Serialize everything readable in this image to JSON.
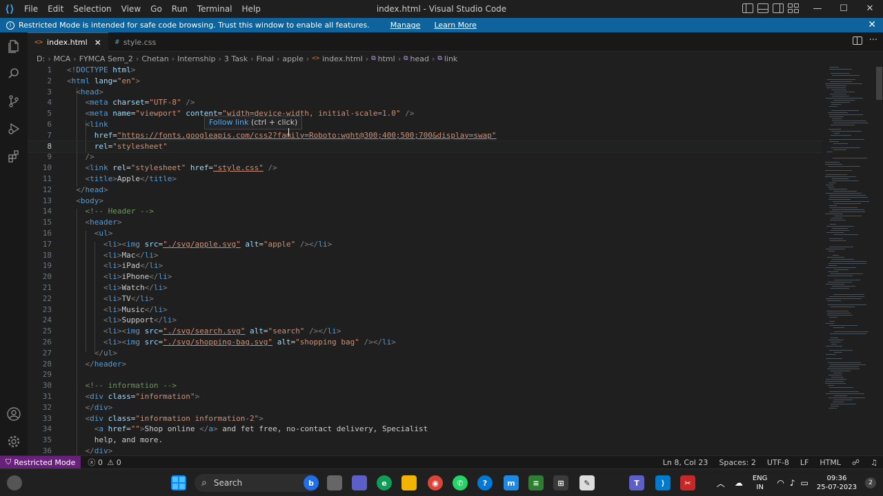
{
  "titlebar": {
    "menu": [
      "File",
      "Edit",
      "Selection",
      "View",
      "Go",
      "Run",
      "Terminal",
      "Help"
    ],
    "title": "index.html - Visual Studio Code",
    "controls": [
      "—",
      "☐",
      "✕"
    ]
  },
  "banner": {
    "message": "Restricted Mode is intended for safe code browsing. Trust this window to enable all features.",
    "manage": "Manage",
    "learn_more": "Learn More"
  },
  "tabs": [
    {
      "icon": "<>",
      "label": "index.html"
    },
    {
      "icon": "#",
      "label": "style.css"
    }
  ],
  "breadcrumbs": [
    "D:",
    "MCA",
    "FYMCA Sem_2",
    "Chetan",
    "Internship",
    "3 Task",
    "Final",
    "apple",
    "index.html",
    "html",
    "head",
    "link"
  ],
  "hover": {
    "link": "Follow link",
    "hint": " (ctrl + click)"
  },
  "editor": {
    "current_line": 8,
    "lines": [
      {
        "n": "1",
        "code": "<!DOCTYPE html>"
      },
      {
        "n": "2",
        "code": "<html lang=\"en\">"
      },
      {
        "n": "3",
        "code": "  <head>"
      },
      {
        "n": "4",
        "code": "    <meta charset=\"UTF-8\" />"
      },
      {
        "n": "5",
        "code": "    <meta name=\"viewport\" content=\"width=device-width, initial-scale=1.0\" />"
      },
      {
        "n": "6",
        "code": "    <link"
      },
      {
        "n": "7",
        "code": "      href=\"https://fonts.googleapis.com/css2?family=Roboto:wght@300;400;500;700&display=swap\""
      },
      {
        "n": "8",
        "code": "      rel=\"stylesheet\""
      },
      {
        "n": "9",
        "code": "    />"
      },
      {
        "n": "10",
        "code": "    <link rel=\"stylesheet\" href=\"style.css\" />"
      },
      {
        "n": "11",
        "code": "    <title>Apple</title>"
      },
      {
        "n": "12",
        "code": "  </head>"
      },
      {
        "n": "13",
        "code": "  <body>"
      },
      {
        "n": "14",
        "code": "    <!-- Header -->"
      },
      {
        "n": "15",
        "code": "    <header>"
      },
      {
        "n": "16",
        "code": "      <ul>"
      },
      {
        "n": "17",
        "code": "        <li><img src=\"./svg/apple.svg\" alt=\"apple\" /></li>"
      },
      {
        "n": "18",
        "code": "        <li>Mac</li>"
      },
      {
        "n": "19",
        "code": "        <li>iPad</li>"
      },
      {
        "n": "20",
        "code": "        <li>iPhone</li>"
      },
      {
        "n": "21",
        "code": "        <li>Watch</li>"
      },
      {
        "n": "22",
        "code": "        <li>TV</li>"
      },
      {
        "n": "23",
        "code": "        <li>Music</li>"
      },
      {
        "n": "24",
        "code": "        <li>Support</li>"
      },
      {
        "n": "25",
        "code": "        <li><img src=\"./svg/search.svg\" alt=\"search\" /></li>"
      },
      {
        "n": "26",
        "code": "        <li><img src=\"./svg/shopping-bag.svg\" alt=\"shopping bag\" /></li>"
      },
      {
        "n": "27",
        "code": "      </ul>"
      },
      {
        "n": "28",
        "code": "    </header>"
      },
      {
        "n": "29",
        "code": ""
      },
      {
        "n": "30",
        "code": "    <!-- information -->"
      },
      {
        "n": "31",
        "code": "    <div class=\"information\">"
      },
      {
        "n": "32",
        "code": "    </div>"
      },
      {
        "n": "33",
        "code": "    <div class=\"information information-2\">"
      },
      {
        "n": "34",
        "code": "      <a href=\"\">Shop online </a> and fet free, no-contact delivery, Specialist"
      },
      {
        "n": "35",
        "code": "      help, and more."
      },
      {
        "n": "36",
        "code": "    </div>"
      }
    ]
  },
  "statusbar": {
    "mode": "Restricted Mode",
    "errors": "0",
    "warnings": "0",
    "position": "Ln 8, Col 23",
    "spaces": "Spaces: 2",
    "encoding": "UTF-8",
    "eol": "LF",
    "language": "HTML"
  },
  "taskbar": {
    "search": "Search",
    "lang_top": "ENG",
    "lang_bottom": "IN",
    "time": "09:36",
    "date": "25-07-2023",
    "notifications": "2"
  },
  "colors": {
    "banner": "#0e639c",
    "restricted": "#68217a",
    "tag": "#569cd6",
    "attr": "#9cdcfe",
    "string": "#ce9178",
    "comment": "#6a9955"
  }
}
